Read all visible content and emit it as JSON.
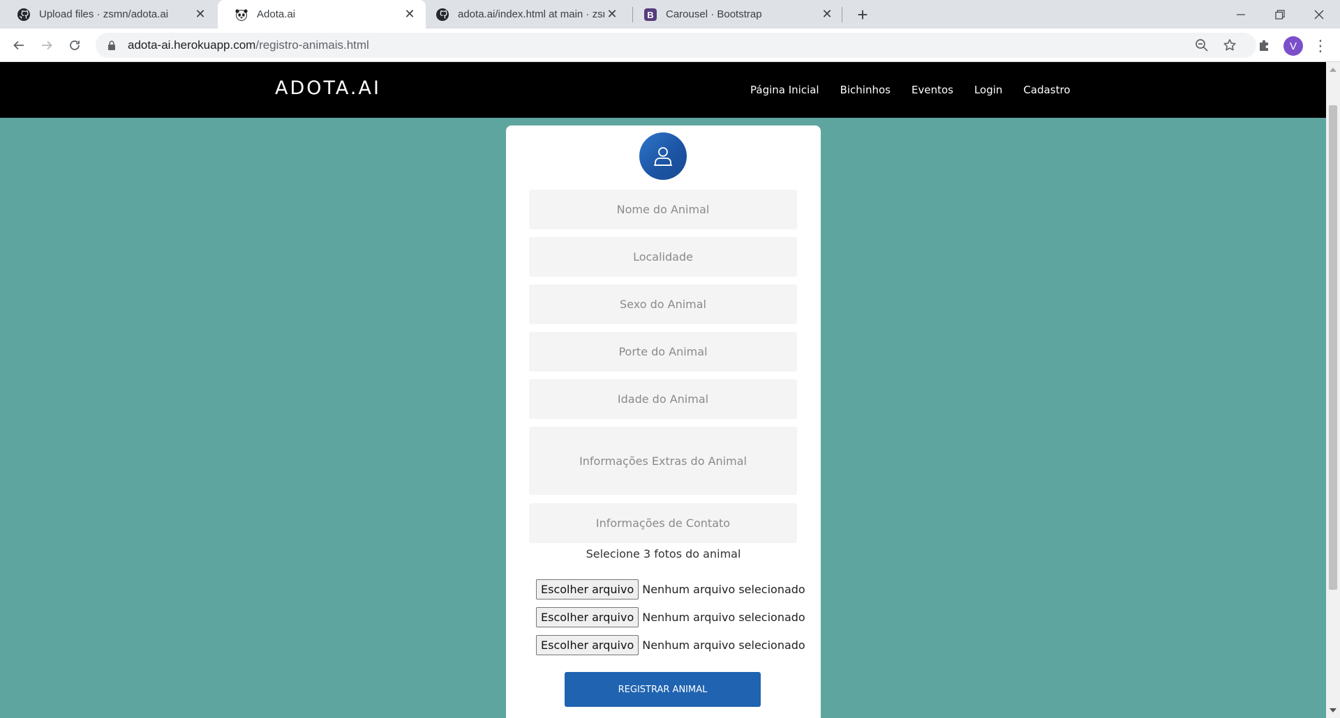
{
  "browser": {
    "tabs": [
      {
        "title": "Upload files · zsmn/adota.ai",
        "icon": "github-icon",
        "active": false
      },
      {
        "title": "Adota.ai",
        "icon": "panda-icon",
        "active": true
      },
      {
        "title": "adota.ai/index.html at main · zsm",
        "icon": "github-icon",
        "active": false
      },
      {
        "title": "Carousel · Bootstrap",
        "icon": "bootstrap-icon",
        "active": false
      }
    ],
    "url_host": "adota-ai.herokuapp.com",
    "url_path": "/registro-animais.html",
    "profile_initial": "V"
  },
  "site": {
    "brand": "ADOTA.AI",
    "nav": [
      "Página Inicial",
      "Bichinhos",
      "Eventos",
      "Login",
      "Cadastro"
    ]
  },
  "form": {
    "fields": {
      "nome": "Nome do Animal",
      "localidade": "Localidade",
      "sexo": "Sexo do Animal",
      "porte": "Porte do Animal",
      "idade": "Idade do Animal",
      "extras": "Informações Extras do Animal",
      "contato": "Informações de Contato"
    },
    "photos_label": "Selecione 3 fotos do animal",
    "file_inputs": [
      {
        "button": "Escolher arquivo",
        "status": "Nenhum arquivo selecionado"
      },
      {
        "button": "Escolher arquivo",
        "status": "Nenhum arquivo selecionado"
      },
      {
        "button": "Escolher arquivo",
        "status": "Nenhum arquivo selecionado"
      }
    ],
    "submit_label": "REGISTRAR ANIMAL"
  },
  "colors": {
    "page_background": "#5ea5a0",
    "navbar": "#000000",
    "accent": "#1f63b1"
  }
}
